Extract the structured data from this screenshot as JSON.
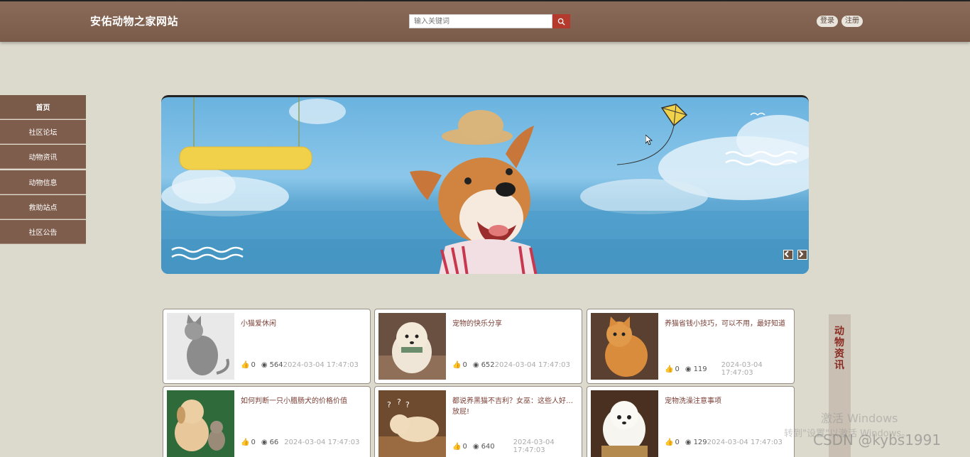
{
  "header": {
    "site_title": "安佑动物之家网站",
    "search_placeholder": "输入关键词",
    "login_label": "登录",
    "register_label": "注册"
  },
  "sidebar": {
    "items": [
      {
        "label": "首页"
      },
      {
        "label": "社区论坛"
      },
      {
        "label": "动物资讯"
      },
      {
        "label": "动物信息"
      },
      {
        "label": "救助站点"
      },
      {
        "label": "社区公告"
      }
    ]
  },
  "side_tab": {
    "label": "动物资讯"
  },
  "cards": [
    {
      "title": "小猫爱休闲",
      "likes": "0",
      "views": "564",
      "date": "2024-03-04 17:47:03"
    },
    {
      "title": "宠物的快乐分享",
      "likes": "0",
      "views": "652",
      "date": "2024-03-04 17:47:03"
    },
    {
      "title": "养猫省钱小技巧，可以不用，最好知道",
      "likes": "0",
      "views": "119",
      "date": "2024-03-04 17:47:03"
    },
    {
      "title": "如何判断一只小腊肠犬的价格价值",
      "likes": "0",
      "views": "66",
      "date": "2024-03-04 17:47:03"
    },
    {
      "title": "都说养黑猫不吉利？女巫：这些人好…放屁!",
      "likes": "0",
      "views": "640",
      "date": "2024-03-04 17:47:03"
    },
    {
      "title": "宠物洗澡注意事项",
      "likes": "0",
      "views": "129",
      "date": "2024-03-04 17:47:03"
    }
  ],
  "watermarks": {
    "line1": "激活 Windows",
    "line2": "转到\"设置\"以激活 Windows。",
    "csdn": "CSDN @kybs1991"
  },
  "colors": {
    "header": "#7a5b4a",
    "accent_red": "#b33a2d",
    "title_text": "#7a3e35"
  }
}
